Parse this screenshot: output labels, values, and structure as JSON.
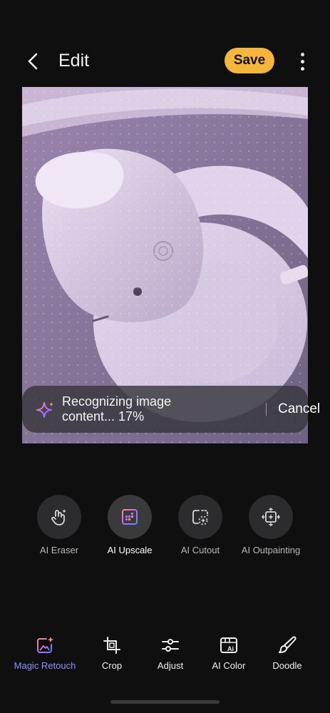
{
  "header": {
    "title": "Edit",
    "save_label": "Save"
  },
  "progress": {
    "message": "Recognizing image content... 17%",
    "percent": 17,
    "cancel_label": "Cancel"
  },
  "ai_tools": [
    {
      "label": "AI Eraser",
      "icon": "eraser-hand-icon"
    },
    {
      "label": "AI Upscale",
      "icon": "upscale-icon",
      "active": true
    },
    {
      "label": "AI Cutout",
      "icon": "cutout-icon"
    },
    {
      "label": "AI Outpainting",
      "icon": "outpainting-icon"
    }
  ],
  "bottom_nav": [
    {
      "label": "Magic Retouch",
      "icon": "magic-retouch-icon",
      "active": true
    },
    {
      "label": "Crop",
      "icon": "crop-icon"
    },
    {
      "label": "Adjust",
      "icon": "adjust-sliders-icon"
    },
    {
      "label": "AI Color",
      "icon": "ai-color-icon"
    },
    {
      "label": "Doodle",
      "icon": "doodle-brush-icon"
    }
  ],
  "colors": {
    "accent": "#f4b63c",
    "active_nav": "#8e93ff",
    "background": "#0f0f10"
  }
}
